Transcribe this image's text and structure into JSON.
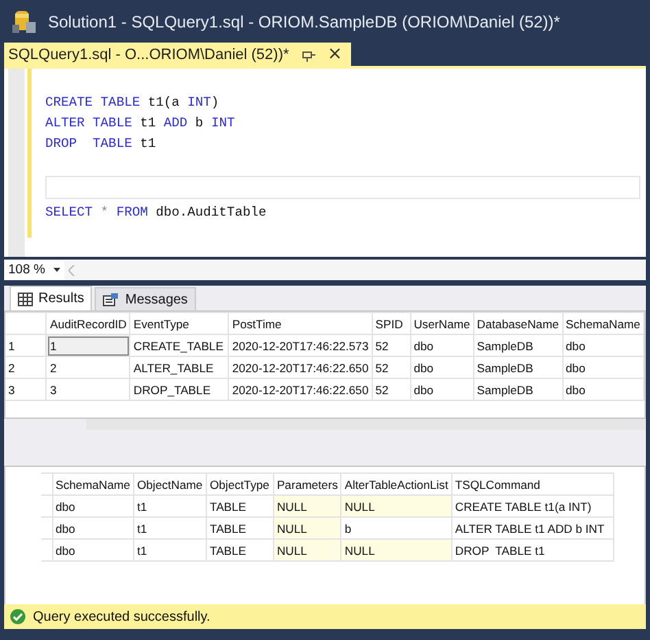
{
  "window": {
    "title": "Solution1 - SQLQuery1.sql - ORIOM.SampleDB (ORIOM\\Daniel (52))*"
  },
  "document_tab": {
    "label": "SQLQuery1.sql - O...ORIOM\\Daniel (52))*",
    "close": "×"
  },
  "editor": {
    "lines": [
      {
        "kind": "blank"
      },
      {
        "kind": "code",
        "tokens": [
          {
            "kind": "keyword",
            "text": "CREATE TABLE"
          },
          {
            "kind": "plain",
            "text": " t1(a "
          },
          {
            "kind": "keyword",
            "text": "INT"
          },
          {
            "kind": "plain",
            "text": ")"
          }
        ]
      },
      {
        "kind": "code",
        "tokens": [
          {
            "kind": "keyword",
            "text": "ALTER TABLE"
          },
          {
            "kind": "plain",
            "text": " t1 "
          },
          {
            "kind": "keyword",
            "text": "ADD"
          },
          {
            "kind": "plain",
            "text": " b "
          },
          {
            "kind": "keyword",
            "text": "INT"
          }
        ]
      },
      {
        "kind": "code",
        "tokens": [
          {
            "kind": "keyword",
            "text": "DROP  TABLE"
          },
          {
            "kind": "plain",
            "text": " t1"
          }
        ]
      },
      {
        "kind": "blank"
      },
      {
        "kind": "current"
      },
      {
        "kind": "code",
        "tokens": [
          {
            "kind": "keyword",
            "text": "SELECT"
          },
          {
            "kind": "operator",
            "text": " * "
          },
          {
            "kind": "keyword",
            "text": "FROM"
          },
          {
            "kind": "plain",
            "text": " dbo.AuditTable"
          }
        ]
      }
    ]
  },
  "zoom": {
    "value": "108 %"
  },
  "results_tabs": [
    {
      "label": "Results",
      "selected": true
    },
    {
      "label": "Messages",
      "selected": false
    }
  ],
  "grids": [
    {
      "columns": [
        "AuditRecordID",
        "EventType",
        "PostTime",
        "SPID",
        "UserName",
        "DatabaseName",
        "SchemaName"
      ],
      "rows": [
        {
          "number": "1",
          "cells": [
            {
              "text": "1",
              "selected": true
            },
            "CREATE_TABLE",
            "2020-12-20T17:46:22.573",
            "52",
            "dbo",
            "SampleDB",
            "dbo"
          ]
        },
        {
          "number": "2",
          "cells": [
            {
              "text": "2",
              "selected": false
            },
            "ALTER_TABLE",
            "2020-12-20T17:46:22.650",
            "52",
            "dbo",
            "SampleDB",
            "dbo"
          ]
        },
        {
          "number": "3",
          "cells": [
            {
              "text": "3",
              "selected": false
            },
            "DROP_TABLE",
            "2020-12-20T17:46:22.650",
            "52",
            "dbo",
            "SampleDB",
            "dbo"
          ]
        }
      ]
    },
    {
      "columns": [
        "SchemaName",
        "ObjectName",
        "ObjectType",
        "Parameters",
        "AlterTableActionList",
        "TSQLCommand"
      ],
      "rows": [
        {
          "cells": [
            "dbo",
            "t1",
            "TABLE",
            {
              "text": "NULL",
              "null": true
            },
            {
              "text": "NULL",
              "null": true
            },
            "CREATE TABLE t1(a INT)"
          ]
        },
        {
          "cells": [
            "dbo",
            "t1",
            "TABLE",
            {
              "text": "NULL",
              "null": true
            },
            "b",
            "ALTER TABLE t1 ADD b INT"
          ]
        },
        {
          "cells": [
            "dbo",
            "t1",
            "TABLE",
            {
              "text": "NULL",
              "null": true
            },
            {
              "text": "NULL",
              "null": true
            },
            "DROP  TABLE t1"
          ]
        }
      ]
    }
  ],
  "status_bar": {
    "text": "Query executed successfully."
  }
}
